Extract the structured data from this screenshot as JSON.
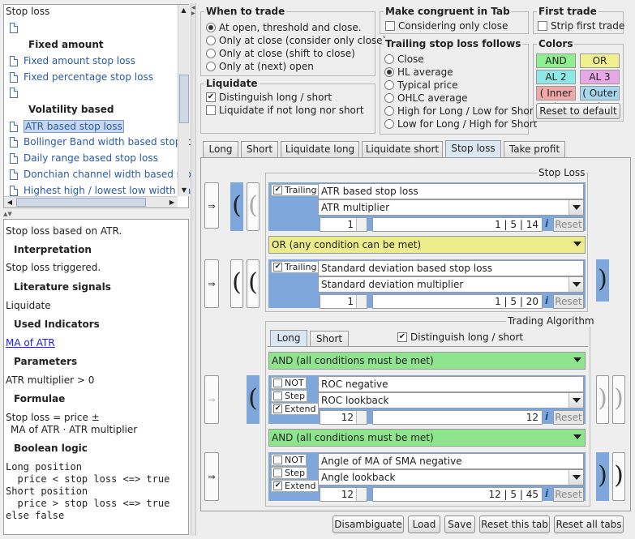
{
  "tree": {
    "header": "Stop loss",
    "items": [
      {
        "label": "",
        "type": "doc"
      },
      {
        "label": "Fixed amount",
        "type": "section"
      },
      {
        "label": "Fixed amount stop loss",
        "type": "link"
      },
      {
        "label": "Fixed percentage stop loss",
        "type": "link"
      },
      {
        "label": "",
        "type": "doc"
      },
      {
        "label": "Volatility based",
        "type": "section"
      },
      {
        "label": "ATR based stop loss",
        "type": "selected"
      },
      {
        "label": "Bollinger Band width based stop lo",
        "type": "link"
      },
      {
        "label": "Daily range based stop loss",
        "type": "link"
      },
      {
        "label": "Donchian channel width based sto",
        "type": "link"
      },
      {
        "label": "Highest high / lowest low width bas",
        "type": "link"
      }
    ]
  },
  "description": {
    "intro": "Stop loss based on ATR.",
    "interpretation_h": "Interpretation",
    "interpretation": "Stop loss triggered.",
    "literature_h": "Literature signals",
    "literature": "Liquidate",
    "indicators_h": "Used Indicators",
    "indicator_link": "MA of ATR",
    "parameters_h": "Parameters",
    "parameters": "ATR multiplier > 0",
    "formulae_h": "Formulae",
    "formula1": "Stop loss = price ±",
    "formula2": "MA of ATR · ATR multiplier",
    "boolean_h": "Boolean logic",
    "boolean": "Long position\n  price < stop loss <=> true\nShort position\n  price > stop loss <=> true\nelse false"
  },
  "when_to_trade": {
    "title": "When to trade",
    "options": [
      "At open, threshold and close.",
      "Only at close (consider only close)",
      "Only at close (shift to close)",
      "Only at (next) open"
    ],
    "selected": 0
  },
  "liquidate": {
    "title": "Liquidate",
    "opt1": "Distinguish long / short",
    "opt1_checked": true,
    "opt2": "Liquidate if not long nor short",
    "opt2_checked": false
  },
  "congruent": {
    "title": "Make congruent in Tab",
    "label": "Considering only close",
    "checked": false
  },
  "trailing": {
    "title": "Trailing stop loss follows",
    "options": [
      "Close",
      "HL average",
      "Typical price",
      "OHLC average",
      "High for Long / Low for Short",
      "Low for Long / High for Short"
    ],
    "selected": 1
  },
  "first_trade": {
    "title": "First trade",
    "label": "Strip first trade",
    "checked": false
  },
  "colors": {
    "title": "Colors",
    "and": "AND",
    "or": "OR",
    "al2": "AL 2",
    "al3": "AL 3",
    "inner": "( Inner )",
    "outer": "( Outer )",
    "reset": "Reset to default",
    "and_color": "#8ef08e",
    "or_color": "#f0f08e",
    "al2_color": "#8ee8e8",
    "al3_color": "#e8a8e8",
    "inner_color": "#f0a8a8",
    "outer_color": "#a8d8f0"
  },
  "tabs": [
    "Long",
    "Short",
    "Liquidate long",
    "Liquidate short",
    "Stop loss",
    "Take profit"
  ],
  "active_tab": "Stop loss",
  "stop_loss": {
    "title": "Stop Loss",
    "row1": {
      "trailing": "Trailing",
      "trailing_checked": true,
      "name": "ATR based stop loss",
      "param": "ATR multiplier",
      "value": "1",
      "range": "1  |  5  |  14",
      "info": "i",
      "reset": "Reset"
    },
    "or_label": "OR    (any condition can be met)",
    "row2": {
      "trailing": "Trailing",
      "trailing_checked": true,
      "name": "Standard deviation based stop loss",
      "param": "Standard deviation multiplier",
      "value": "1",
      "range": "1  |  5  |  20",
      "info": "i",
      "reset": "Reset"
    }
  },
  "trading_algorithm": {
    "title": "Trading Algorithm",
    "tabs": [
      "Long",
      "Short"
    ],
    "distinguish": "Distinguish long / short",
    "distinguish_checked": true,
    "and1": "AND    (all conditions must be met)",
    "cond1": {
      "not": "NOT",
      "step": "Step",
      "extend": "Extend",
      "extend_checked": true,
      "name": "ROC negative",
      "param": "ROC lookback",
      "value": "12",
      "range": "12",
      "info": "i",
      "reset": "Reset"
    },
    "and2": "AND    (all conditions must be met)",
    "cond2": {
      "not": "NOT",
      "step": "Step",
      "extend": "Extend",
      "extend_checked": true,
      "name": "Angle of MA of SMA negative",
      "param": "Angle lookback",
      "value": "12",
      "range": "12  |  5  |  45",
      "info": "i",
      "reset": "Reset"
    }
  },
  "bottom_buttons": {
    "disambiguate": "Disambiguate",
    "load": "Load",
    "save": "Save",
    "reset_tab": "Reset this tab",
    "reset_all": "Reset all tabs"
  },
  "symbols": {
    "implies": "⇒",
    "open_paren": "(",
    "close_paren": ")",
    "check": "✔"
  }
}
